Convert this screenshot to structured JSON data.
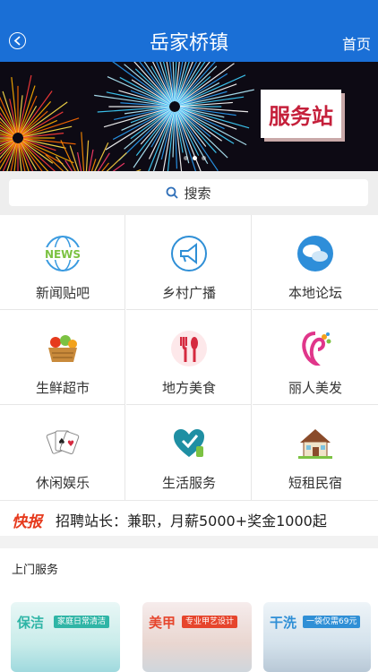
{
  "header": {
    "title": "岳家桥镇",
    "home_label": "首页",
    "color": "#1a6fd6"
  },
  "banner": {
    "sign_text": "服务站",
    "slides": 3,
    "active_slide": 1
  },
  "search": {
    "label": "搜索"
  },
  "grid": [
    {
      "label": "新闻贴吧",
      "icon": "news-icon"
    },
    {
      "label": "乡村广播",
      "icon": "megaphone-icon"
    },
    {
      "label": "本地论坛",
      "icon": "chat-bubbles-icon"
    },
    {
      "label": "生鲜超市",
      "icon": "produce-basket-icon"
    },
    {
      "label": "地方美食",
      "icon": "cutlery-icon"
    },
    {
      "label": "丽人美发",
      "icon": "beauty-portrait-icon"
    },
    {
      "label": "休闲娱乐",
      "icon": "playing-cards-icon"
    },
    {
      "label": "生活服务",
      "icon": "heart-cleaning-icon"
    },
    {
      "label": "短租民宿",
      "icon": "house-icon"
    }
  ],
  "news": {
    "badge": "快报",
    "text": "招聘站长：兼职，月薪5000+奖金1000起"
  },
  "section": {
    "title": "上门服务"
  },
  "cards": [
    {
      "title": "保洁",
      "tag": "家庭日常清洁",
      "color": "#2fb5a6"
    },
    {
      "title": "美甲",
      "tag": "专业甲艺设计",
      "color": "#e6452c"
    },
    {
      "title": "干洗",
      "tag": "一袋仅需69元",
      "color": "#2f8fd6"
    }
  ]
}
